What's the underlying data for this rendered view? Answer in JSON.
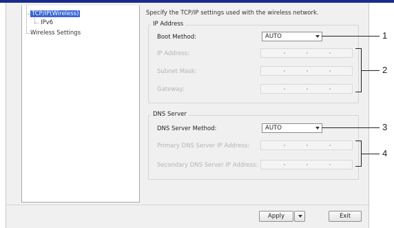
{
  "tree": {
    "items": [
      {
        "label": "TCP/IP(Wireless)",
        "selected": true
      },
      {
        "label": "IPv6",
        "selected": false
      },
      {
        "label": "Wireless Settings",
        "selected": false
      }
    ]
  },
  "main": {
    "description": "Specify the TCP/IP settings used with the wireless network.",
    "ip_address": {
      "title": "IP Address",
      "boot_method_label": "Boot Method:",
      "boot_method_value": "AUTO",
      "ip_address_label": "IP Address:",
      "subnet_mask_label": "Subnet Mask:",
      "gateway_label": "Gateway:"
    },
    "dns_server": {
      "title": "DNS Server",
      "method_label": "DNS Server Method:",
      "method_value": "AUTO",
      "primary_label": "Primary DNS Server IP Address:",
      "secondary_label": "Secondary DNS Server IP Address:"
    }
  },
  "buttons": {
    "apply": "Apply",
    "exit": "Exit"
  },
  "callouts": [
    "1",
    "2",
    "3",
    "4"
  ],
  "colors": {
    "selection": "#3a66d6",
    "title_bar": "#1a2a8c",
    "disabled_text": "#b4b4b4"
  }
}
